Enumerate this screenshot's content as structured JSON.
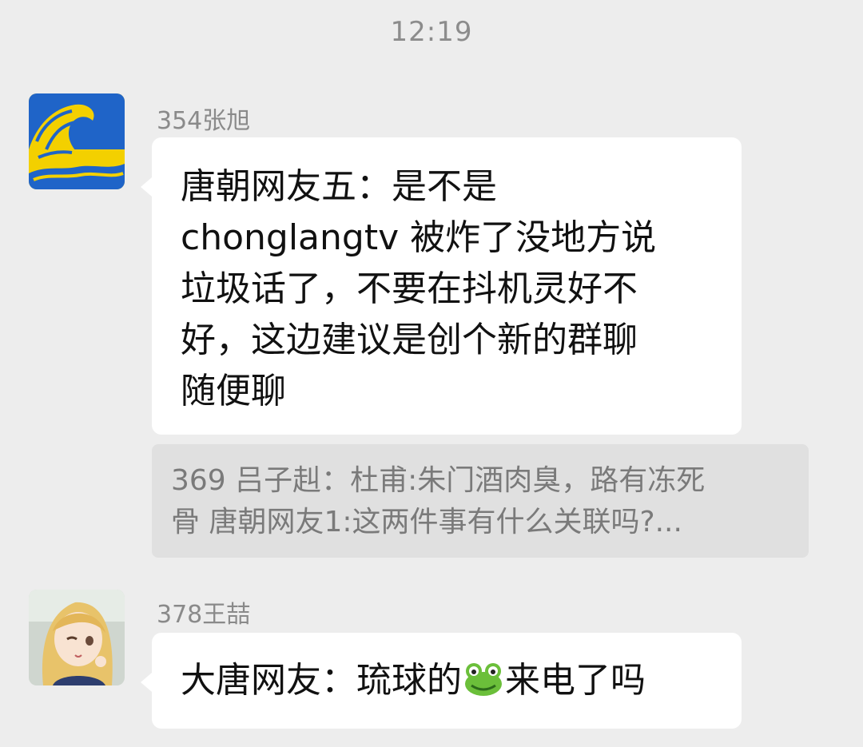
{
  "status": {
    "time": "12:19"
  },
  "messages": [
    {
      "sender": "354张旭",
      "avatar_icon": "great-wave-avatar",
      "text_lines": [
        "唐朝网友五：是不是",
        "chonglangtv 被炸了没地方说",
        "垃圾话了，不要在抖机灵好不",
        "好，这边建议是创个新的群聊",
        "随便聊"
      ],
      "quote_lines": [
        "369 吕子赳：杜甫:朱门酒肉臭，路有冻死",
        "骨  唐朝网友1:这两件事有什么关联吗?..."
      ]
    },
    {
      "sender": "378王喆",
      "avatar_icon": "anime-girl-avatar",
      "text_before_emoji": "大唐网友：琉球的",
      "emoji": "frog-emoji",
      "text_after_emoji": "来电了吗"
    }
  ],
  "colors": {
    "background": "#ededed",
    "bubble": "#ffffff",
    "quote_bg": "#e0e0e0",
    "name_text": "#8a8a8a",
    "time_text": "#8c8c8c"
  }
}
